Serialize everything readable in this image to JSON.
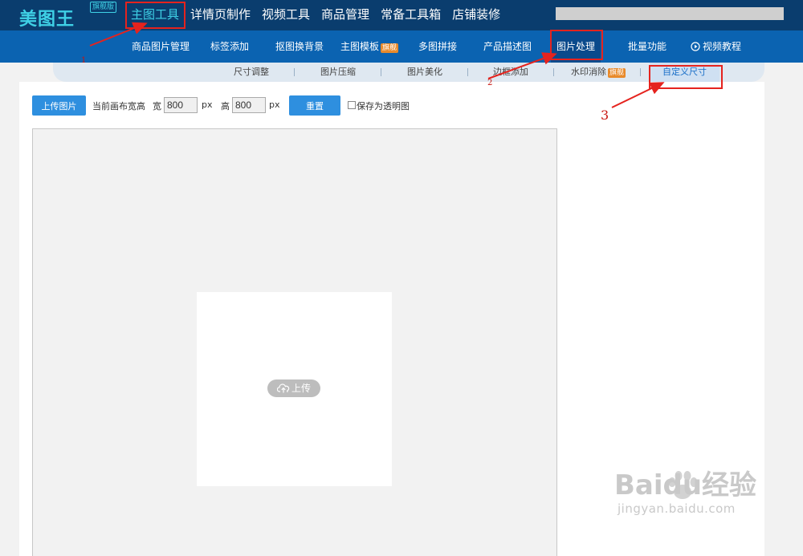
{
  "brand": {
    "name": "美图王",
    "badge": "旗舰版"
  },
  "main_nav": [
    "主图工具",
    "详情页制作",
    "视频工具",
    "商品管理",
    "常备工具箱",
    "店铺装修"
  ],
  "sub_nav": {
    "items": [
      "商品图片管理",
      "标签添加",
      "抠图换背景",
      "主图模板",
      "多图拼接",
      "产品描述图",
      "图片处理",
      "批量功能",
      "视频教程"
    ],
    "flag": "旗舰"
  },
  "third_nav": {
    "items": [
      "尺寸调整",
      "图片压缩",
      "图片美化",
      "边框添加",
      "水印消除",
      "自定义尺寸"
    ],
    "flag": "旗舰"
  },
  "toolbar": {
    "upload_label": "上传图片",
    "canvas_size_label": "当前画布宽高",
    "width_label": "宽",
    "width_value": "800",
    "height_label": "高",
    "height_value": "800",
    "unit": "px",
    "reset_label": "重置",
    "transparent_label": "保存为透明图"
  },
  "canvas": {
    "upload_label": "上传"
  },
  "annotations": [
    "1",
    "2",
    "3"
  ],
  "watermark": {
    "brand": "Baidu经验",
    "url": "jingyan.baidu.com"
  },
  "colors": {
    "topbar": "#0a3d6e",
    "subnav": "#0b63b1",
    "accent": "#3fd1e6",
    "button": "#2e8fdf",
    "annotation": "#e5231e"
  }
}
